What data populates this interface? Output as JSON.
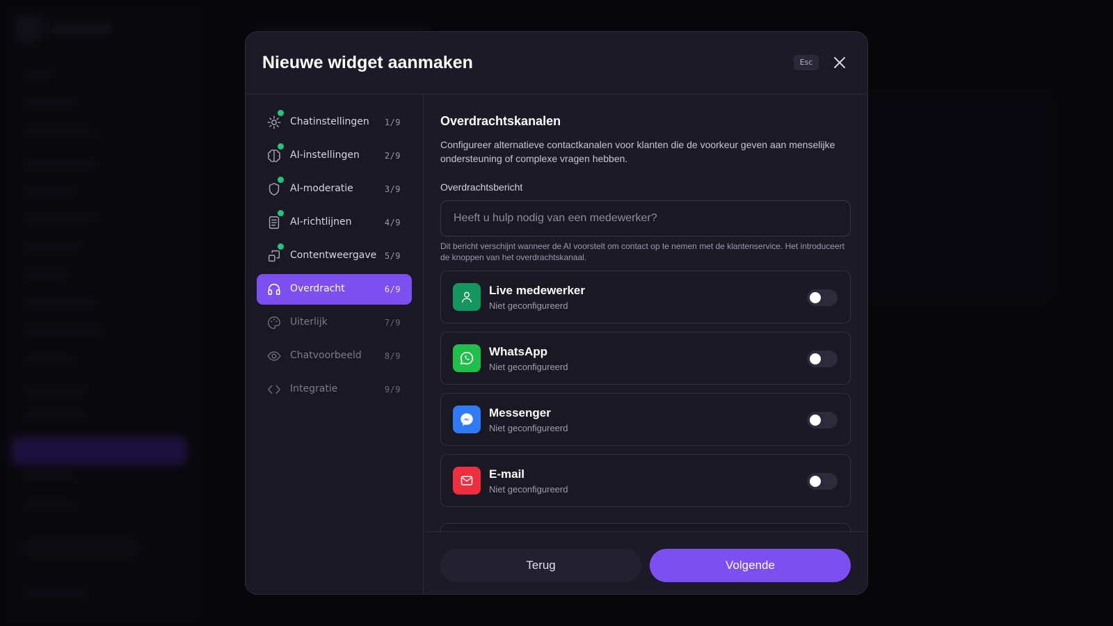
{
  "modal": {
    "title": "Nieuwe widget aanmaken",
    "esc_label": "Esc"
  },
  "steps": [
    {
      "label": "Chatinstellingen",
      "count": "1/9",
      "icon": "gear-icon",
      "status": "completed"
    },
    {
      "label": "AI-instellingen",
      "count": "2/9",
      "icon": "brain-icon",
      "status": "completed"
    },
    {
      "label": "AI-moderatie",
      "count": "3/9",
      "icon": "shield-icon",
      "status": "completed"
    },
    {
      "label": "AI-richtlijnen",
      "count": "4/9",
      "icon": "document-icon",
      "status": "completed"
    },
    {
      "label": "Contentweergave",
      "count": "5/9",
      "icon": "layout-icon",
      "status": "completed"
    },
    {
      "label": "Overdracht",
      "count": "6/9",
      "icon": "headphones-icon",
      "status": "active"
    },
    {
      "label": "Uiterlijk",
      "count": "7/9",
      "icon": "palette-icon",
      "status": "pending"
    },
    {
      "label": "Chatvoorbeeld",
      "count": "8/9",
      "icon": "eye-icon",
      "status": "pending"
    },
    {
      "label": "Integratie",
      "count": "9/9",
      "icon": "code-icon",
      "status": "pending"
    }
  ],
  "content": {
    "title": "Overdrachtskanalen",
    "description": "Configureer alternatieve contactkanalen voor klanten die de voorkeur geven aan menselijke ondersteuning of complexe vragen hebben.",
    "message_label": "Overdrachtsbericht",
    "message_placeholder": "Heeft u hulp nodig van een medewerker?",
    "message_help": "Dit bericht verschijnt wanneer de AI voorstelt om contact op te nemen met de klantenservice. Het introduceert de knoppen van het overdrachtskanaal."
  },
  "channels": [
    {
      "name": "Live medewerker",
      "status": "Niet geconfigureerd",
      "icon": "person-icon",
      "color": "#14965f",
      "enabled": false
    },
    {
      "name": "WhatsApp",
      "status": "Niet geconfigureerd",
      "icon": "whatsapp-icon",
      "color": "#1fbf4c",
      "enabled": false
    },
    {
      "name": "Messenger",
      "status": "Niet geconfigureerd",
      "icon": "messenger-icon",
      "color": "#2f7bf5",
      "enabled": false
    },
    {
      "name": "E-mail",
      "status": "Niet geconfigureerd",
      "icon": "mail-icon",
      "color": "#ef2e40",
      "enabled": false
    }
  ],
  "footer": {
    "back_label": "Terug",
    "next_label": "Volgende"
  },
  "colors": {
    "accent": "#7b4ff2",
    "check": "#1ec77d"
  }
}
